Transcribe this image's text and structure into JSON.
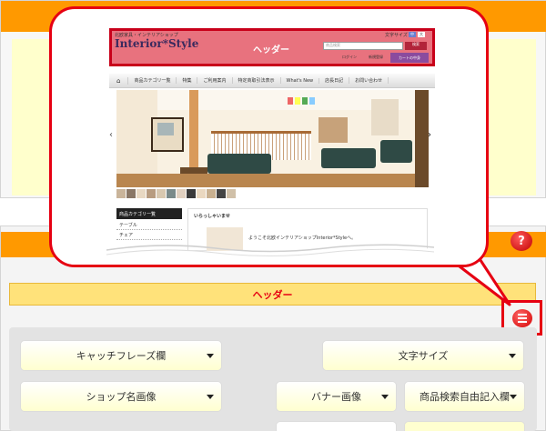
{
  "preview": {
    "shop_subtitle": "北欧家具・インテリアショップ",
    "logo": "Interior*Style",
    "header_label": "ヘッダー",
    "font_size_label": "文字サイズ",
    "font_size_options": [
      "中",
      "大"
    ],
    "search_placeholder": "商品検索",
    "search_button": "検索",
    "login": "ログイン",
    "register": "新規登録",
    "cart": "カートの中身",
    "nav": [
      "商品カテゴリ一覧",
      "特集",
      "ご利用案内",
      "特定商取引法表示",
      "What's New",
      "店長日記",
      "お問い合わせ"
    ],
    "sidebar_title": "商品カテゴリ一覧",
    "sidebar_items": [
      "テーブル",
      "チェア"
    ],
    "welcome_title": "いらっしゃいませ",
    "welcome_text": "ようこそ北欧インテリアショップInterior*Styleへ。",
    "prev_arrow": "‹",
    "next_arrow": "›"
  },
  "editor": {
    "header_bar_label": "ヘッダー",
    "help_icon": "?",
    "dropdowns": {
      "catchphrase": "キャッチフレーズ欄",
      "font_size": "文字サイズ",
      "shop_name_image": "ショップ名画像",
      "banner_image": "バナー画像",
      "product_search_free": "商品検索自由記入欄"
    }
  },
  "colors": {
    "orange": "#ff9900",
    "highlight_red": "#e60012",
    "header_yellow": "#ffe27a"
  }
}
